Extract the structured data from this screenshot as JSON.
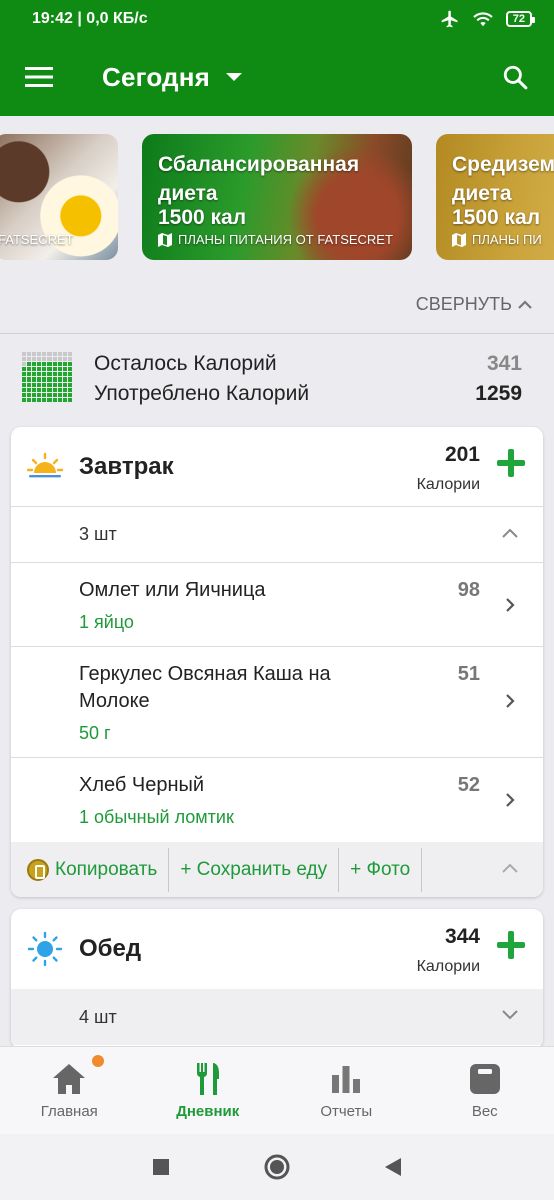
{
  "status_bar": {
    "time": "19:42 | 0,0 КБ/с",
    "battery": "72"
  },
  "app_bar": {
    "title": "Сегодня"
  },
  "meal_plans": [
    {
      "title_lines": [
        "",
        ""
      ],
      "calories": "",
      "source": "ИЯ ОТ FATSECRET"
    },
    {
      "title_lines": [
        "Сбалансированная",
        "диета"
      ],
      "calories": "1500 кал",
      "source": "ПЛАНЫ ПИТАНИЯ ОТ FATSECRET"
    },
    {
      "title_lines": [
        "Средизем",
        "диета"
      ],
      "calories": "1500 кал",
      "source": "ПЛАНЫ ПИ"
    }
  ],
  "collapse_label": "СВЕРНУТЬ",
  "summary": {
    "remaining_label": "Осталось Калорий",
    "remaining_value": "341",
    "consumed_label": "Употреблено Калорий",
    "consumed_value": "1259",
    "progress_fraction": 0.787
  },
  "meals": [
    {
      "name": "Завтрак",
      "calories": "201",
      "calories_label": "Калории",
      "count": "3 шт",
      "foods": [
        {
          "name": "Омлет или Яичница",
          "portion": "1 яйцо",
          "calories": "98"
        },
        {
          "name_lines": [
            "Геркулес Овсяная Каша на",
            "Молоке"
          ],
          "portion": "50 г",
          "calories": "51"
        },
        {
          "name": "Хлеб Черный",
          "portion": "1 обычный ломтик",
          "calories": "52"
        }
      ],
      "actions": {
        "copy": "Копировать",
        "save": "+ Сохранить еду",
        "photo": "+ Фото"
      }
    },
    {
      "name": "Обед",
      "calories": "344",
      "calories_label": "Калории",
      "count": "4 шт"
    }
  ],
  "bottom_nav": [
    {
      "label": "Главная"
    },
    {
      "label": "Дневник"
    },
    {
      "label": "Отчеты"
    },
    {
      "label": "Вес"
    }
  ],
  "colors": {
    "brand_green": "#0f8a12",
    "accent_green": "#1e9a3a",
    "badge_orange": "#f08a2a"
  }
}
